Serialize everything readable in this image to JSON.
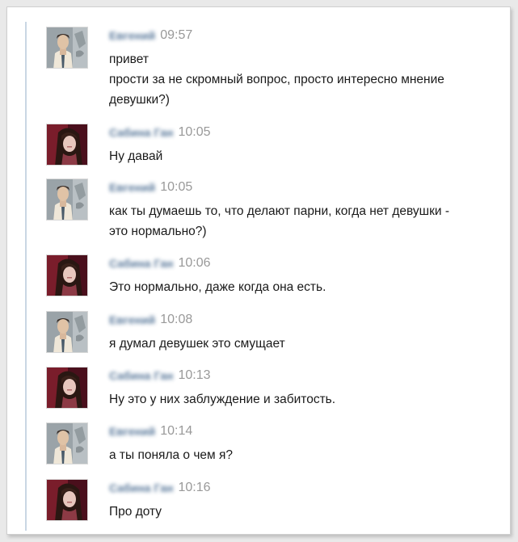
{
  "messages": [
    {
      "author": "Евгений",
      "time": "09:57",
      "avatar": "male",
      "lines": [
        "привет",
        "прости за не скромный вопрос, просто интересно мнение",
        "девушки?)"
      ]
    },
    {
      "author": "Сабина Ган",
      "time": "10:05",
      "avatar": "female",
      "lines": [
        "Ну давай"
      ]
    },
    {
      "author": "Евгений",
      "time": "10:05",
      "avatar": "male",
      "lines": [
        "как ты думаешь то, что делают парни, когда нет девушки -",
        "это нормально?)"
      ]
    },
    {
      "author": "Сабина Ган",
      "time": "10:06",
      "avatar": "female",
      "lines": [
        "Это нормально, даже когда она есть."
      ]
    },
    {
      "author": "Евгений",
      "time": "10:08",
      "avatar": "male",
      "lines": [
        "я думал девушек это смущает"
      ]
    },
    {
      "author": "Сабина Ган",
      "time": "10:13",
      "avatar": "female",
      "lines": [
        "Ну это у них заблуждение и забитость."
      ]
    },
    {
      "author": "Евгений",
      "time": "10:14",
      "avatar": "male",
      "lines": [
        "а ты поняла о чем я?"
      ]
    },
    {
      "author": "Сабина Ган",
      "time": "10:16",
      "avatar": "female",
      "lines": [
        "Про доту"
      ]
    }
  ],
  "colors": {
    "author": "#45688e",
    "time": "#999999",
    "text": "#1a1a1a",
    "thread_line": "#c9d6e4"
  }
}
